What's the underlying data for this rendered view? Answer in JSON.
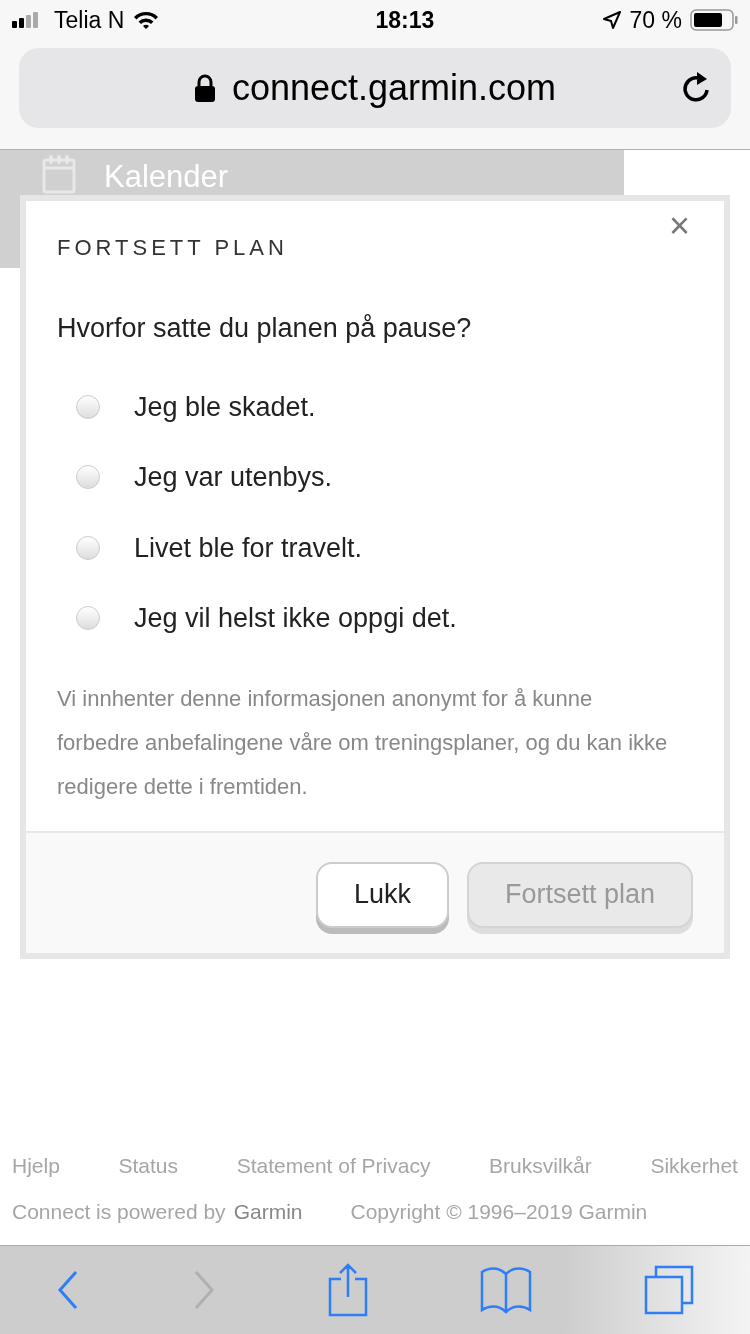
{
  "status_bar": {
    "carrier": "Telia N",
    "time": "18:13",
    "battery": "70 %"
  },
  "address_bar": {
    "url": "connect.garmin.com"
  },
  "nav": {
    "label": "Kalender"
  },
  "dialog": {
    "title": "FORTSETT PLAN",
    "close": "×",
    "question": "Hvorfor satte du planen på pause?",
    "options": [
      {
        "label": "Jeg ble skadet.",
        "selected": false
      },
      {
        "label": "Jeg var utenbys.",
        "selected": false
      },
      {
        "label": "Livet ble for travelt.",
        "selected": false
      },
      {
        "label": "Jeg vil helst ikke oppgi det.",
        "selected": false
      }
    ],
    "note": "Vi innhenter denne informasjonen anonymt for å kunne forbedre anbefalingene våre om treningsplaner, og du kan ikke redigere dette i fremtiden.",
    "buttons": [
      {
        "label": "Lukk",
        "disabled": false
      },
      {
        "label": "Fortsett plan",
        "disabled": true
      }
    ]
  },
  "footer": {
    "links": [
      "Hjelp",
      "Status",
      "Statement of Privacy",
      "Bruksvilkår",
      "Sikkerhet"
    ],
    "powered_by": "Connect is powered by",
    "powered_link": "Garmin",
    "copyright": "Copyright © 1996–2019 Garmin"
  },
  "toolbar": [
    {
      "kind": "back",
      "disabled": false
    },
    {
      "kind": "forward",
      "disabled": true
    },
    {
      "kind": "share",
      "disabled": false
    },
    {
      "kind": "bookmarks",
      "disabled": false
    },
    {
      "kind": "tabs",
      "disabled": false
    }
  ]
}
